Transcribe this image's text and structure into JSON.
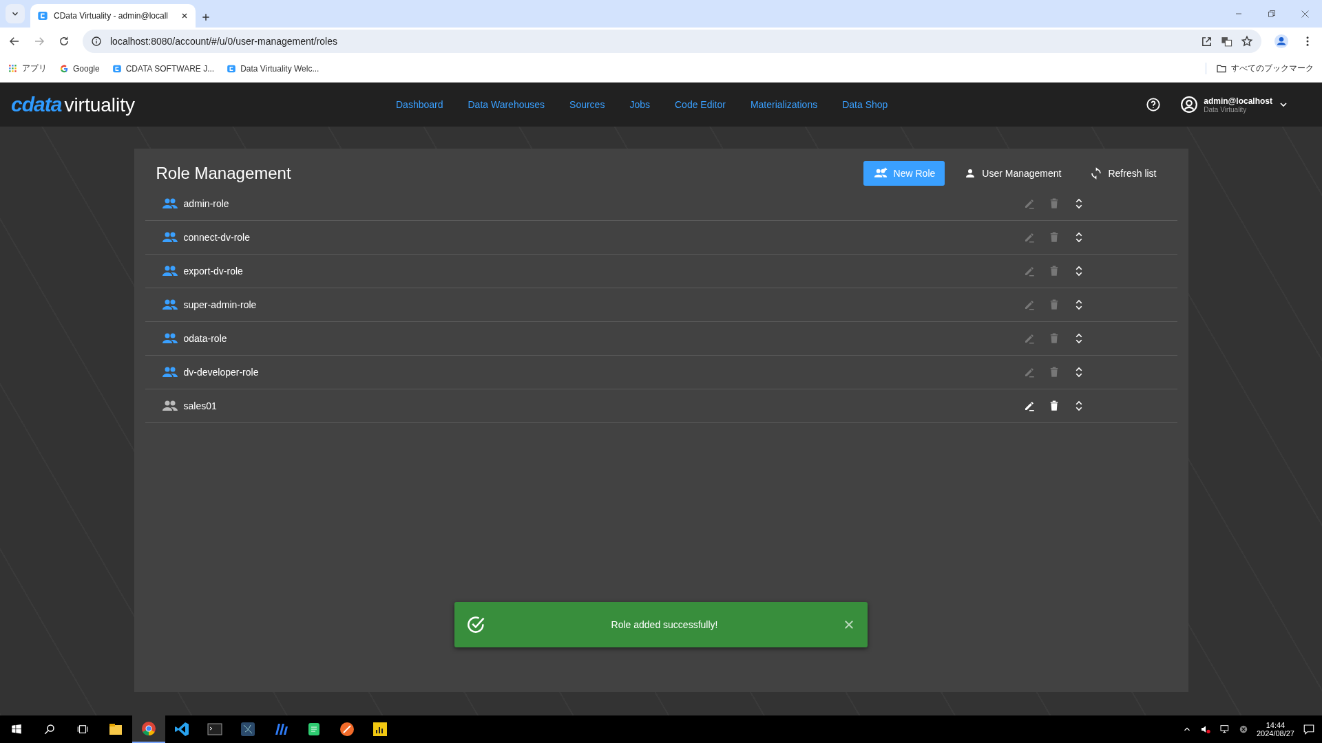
{
  "browser": {
    "tab_title": "CData Virtuality - admin@locall",
    "address": "localhost:8080/account/#/u/0/user-management/roles",
    "bookmarks": [
      {
        "label": "アプリ",
        "kind": "apps"
      },
      {
        "label": "Google",
        "kind": "google"
      },
      {
        "label": "CDATA SOFTWARE J...",
        "kind": "cdata"
      },
      {
        "label": "Data Virtuality Welc...",
        "kind": "cdata"
      }
    ],
    "all_bookmarks": "すべてのブックマーク"
  },
  "app": {
    "logo": {
      "brand": "cdata",
      "product": "virtuality"
    },
    "nav": [
      {
        "label": "Dashboard"
      },
      {
        "label": "Data Warehouses"
      },
      {
        "label": "Sources"
      },
      {
        "label": "Jobs"
      },
      {
        "label": "Code Editor"
      },
      {
        "label": "Materializations"
      },
      {
        "label": "Data Shop"
      }
    ],
    "user": {
      "name": "admin@localhost",
      "subtitle": "Data Virtuality"
    }
  },
  "page": {
    "title": "Role Management",
    "actions": [
      {
        "label": "New Role",
        "kind": "primary"
      },
      {
        "label": "User Management",
        "kind": "user"
      },
      {
        "label": "Refresh list",
        "kind": "refresh"
      }
    ],
    "roles": [
      {
        "name": "admin-role",
        "editable": false
      },
      {
        "name": "connect-dv-role",
        "editable": false
      },
      {
        "name": "export-dv-role",
        "editable": false
      },
      {
        "name": "super-admin-role",
        "editable": false
      },
      {
        "name": "odata-role",
        "editable": false
      },
      {
        "name": "dv-developer-role",
        "editable": false
      },
      {
        "name": "sales01",
        "editable": true
      }
    ]
  },
  "toast": {
    "message": "Role added successfully!"
  },
  "taskbar": {
    "apps": [
      {
        "kind": "explorer",
        "selected": false
      },
      {
        "kind": "chrome",
        "selected": true
      },
      {
        "kind": "vscode",
        "selected": false
      },
      {
        "kind": "terminal",
        "selected": false
      },
      {
        "kind": "dbtool",
        "selected": false
      },
      {
        "kind": "bluetool",
        "selected": false
      },
      {
        "kind": "sheet",
        "selected": false
      },
      {
        "kind": "orange",
        "selected": false
      },
      {
        "kind": "chart",
        "selected": false
      }
    ],
    "time": "14:44",
    "date": "2024/08/27"
  }
}
